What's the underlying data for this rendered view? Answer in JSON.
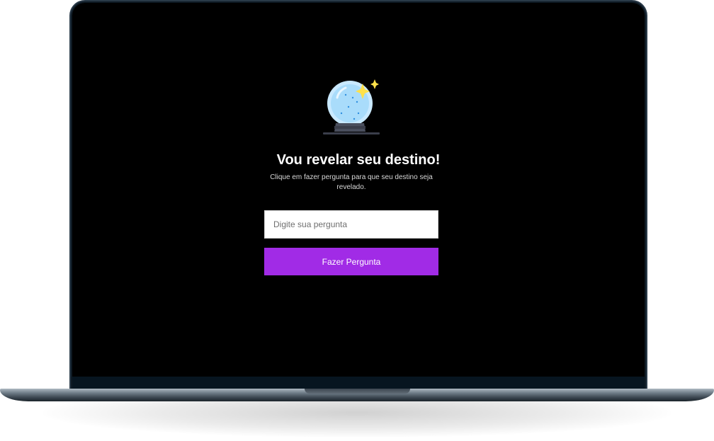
{
  "page": {
    "title": "Vou revelar seu destino!",
    "subtitle": "Clique em fazer pergunta para que seu destino seja revelado."
  },
  "form": {
    "input_placeholder": "Digite sua pergunta",
    "input_value": "",
    "button_label": "Fazer Pergunta"
  },
  "icons": {
    "hero": "crystal-ball-icon",
    "accents": [
      "sparkle-icon"
    ]
  },
  "colors": {
    "background": "#000000",
    "accent": "#a12be6",
    "title": "#ffffff",
    "sparkle": "#ffe14a"
  }
}
